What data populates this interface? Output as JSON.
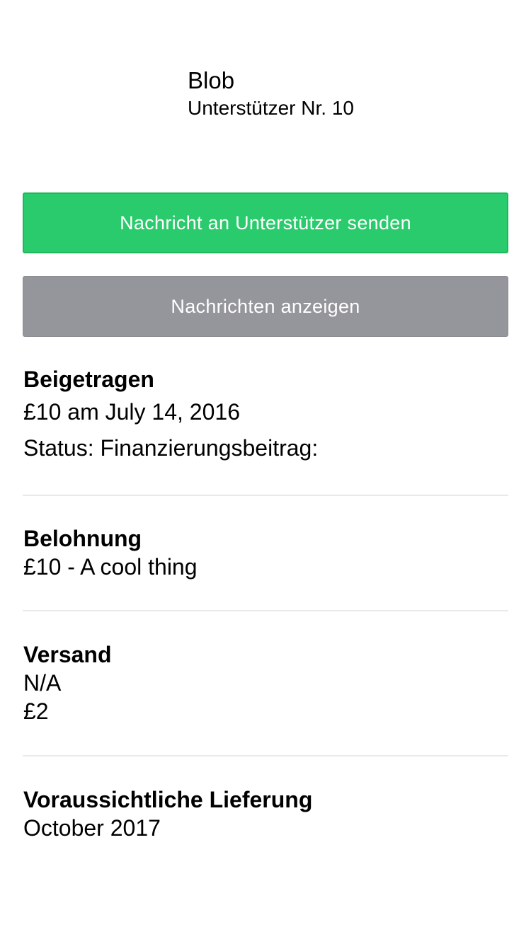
{
  "backer": {
    "name": "Blob",
    "sequence": "Unterstützer Nr. 10"
  },
  "actions": {
    "message_label": "Nachricht an Unterstützer senden",
    "view_messages_label": "Nachrichten anzeigen"
  },
  "colors": {
    "primary_button": "#2ACB6C",
    "secondary_button": "#95969C",
    "divider": "#E9E9EB"
  },
  "contributed": {
    "title": "Beigetragen",
    "amount_date": "£10 am July 14, 2016",
    "status": "Status: Finanzierungsbeitrag:"
  },
  "reward": {
    "title": "Belohnung",
    "description": "£10 - A cool thing"
  },
  "shipping": {
    "title": "Versand",
    "location": "N/A",
    "amount": "£2"
  },
  "delivery": {
    "title": "Voraussichtliche Lieferung",
    "date": "October 2017"
  }
}
